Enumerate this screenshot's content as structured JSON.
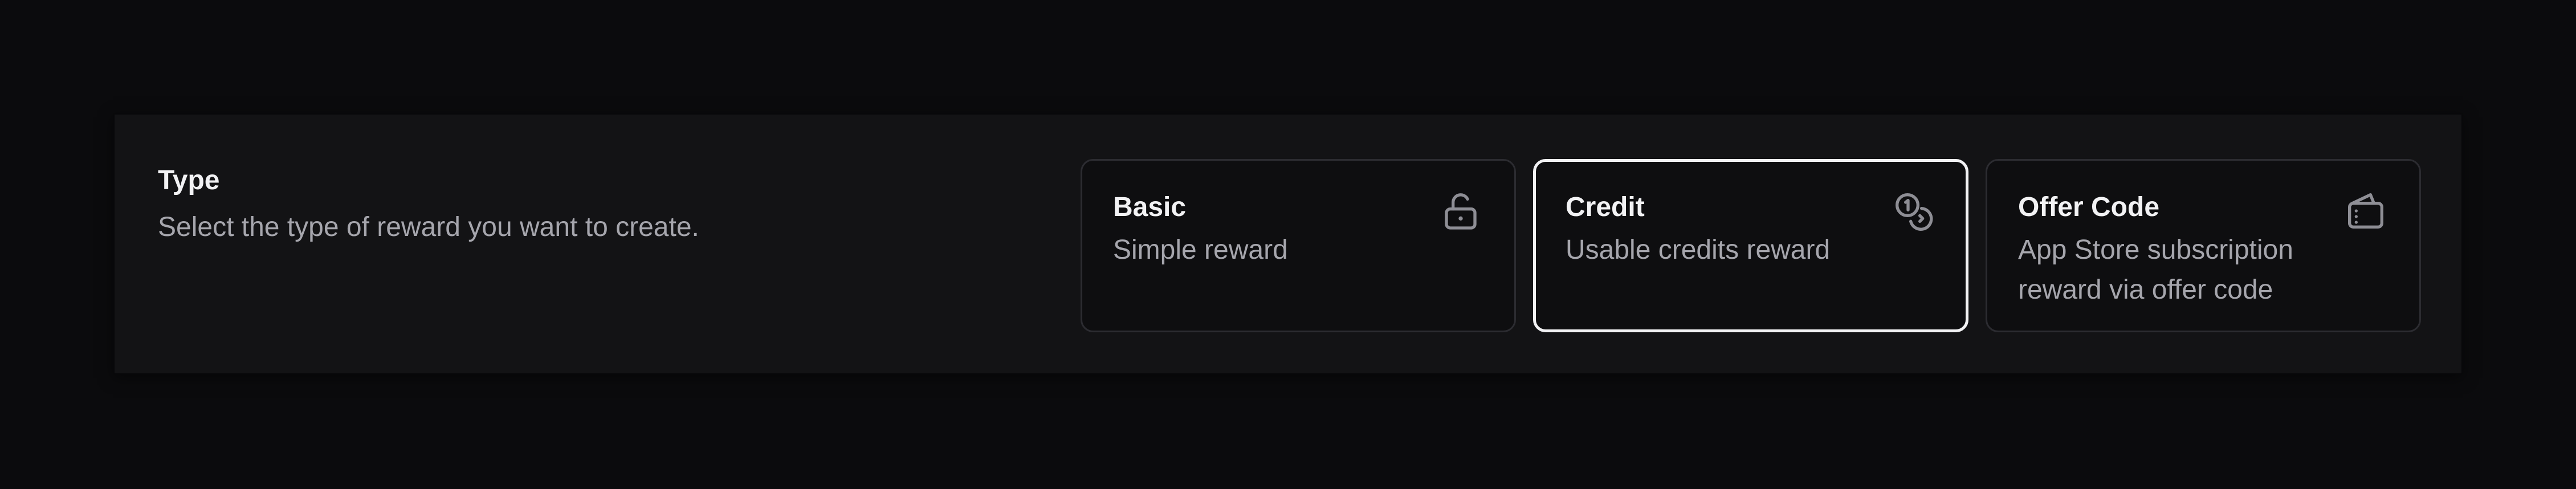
{
  "section": {
    "title": "Type",
    "description": "Select the type of reward you want to create."
  },
  "options": [
    {
      "title": "Basic",
      "description": "Simple reward",
      "icon": "unlock-icon",
      "selected": false
    },
    {
      "title": "Credit",
      "description": "Usable credits reward",
      "icon": "coins-icon",
      "selected": true
    },
    {
      "title": "Offer Code",
      "description": "App Store subscription reward via offer code",
      "icon": "wallet-icon",
      "selected": false
    }
  ],
  "colors": {
    "background": "#0b0b0d",
    "panel": "#131315",
    "card": "#0e0e10",
    "card_border": "#2c2c31",
    "selected_border": "#f2f2f4",
    "text_primary": "#f2f2f4",
    "text_secondary": "#a6a6ad",
    "icon": "#8e8e95"
  }
}
